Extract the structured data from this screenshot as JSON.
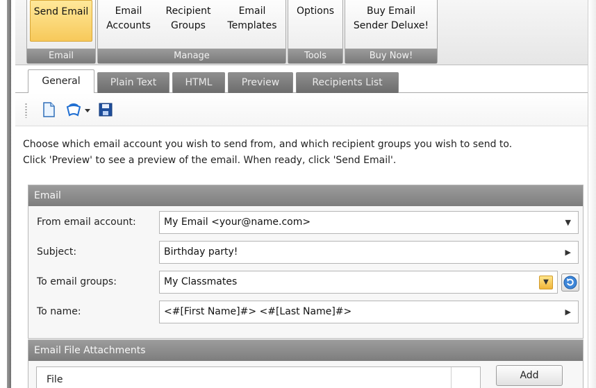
{
  "ribbon": {
    "groups": [
      {
        "footer": "Email",
        "buttons": [
          {
            "label1": "Send Email",
            "label2": ""
          }
        ]
      },
      {
        "footer": "Manage",
        "buttons": [
          {
            "label1": "Email",
            "label2": "Accounts"
          },
          {
            "label1": "Recipient",
            "label2": "Groups"
          },
          {
            "label1": "Email",
            "label2": "Templates"
          }
        ]
      },
      {
        "footer": "Tools",
        "buttons": [
          {
            "label1": "Options",
            "label2": ""
          }
        ]
      },
      {
        "footer": "Buy Now!",
        "buttons": [
          {
            "label1": "Buy Email",
            "label2": "Sender Deluxe!"
          }
        ]
      }
    ]
  },
  "tabs": [
    "General",
    "Plain Text",
    "HTML",
    "Preview",
    "Recipients List"
  ],
  "toolbar": {
    "icons": [
      "new-document-icon",
      "open-icon",
      "dropdown-arrow-icon",
      "save-icon"
    ]
  },
  "description": {
    "line1": "Choose which email account you wish to send from, and which recipient groups you wish to send to.",
    "line2": "Click 'Preview' to see a preview of the email. When ready, click 'Send Email'."
  },
  "email_panel": {
    "title": "Email",
    "fields": [
      {
        "label": "From email account:",
        "value": "My Email <your@name.com>",
        "arrow": "▼"
      },
      {
        "label": "Subject:",
        "value": "Birthday party!",
        "arrow": "▶"
      },
      {
        "label": "To email groups:",
        "value": "My Classmates",
        "arrow": "▼"
      },
      {
        "label": "To name:",
        "value": "<#[First Name]#> <#[Last Name]#>",
        "arrow": "▶"
      }
    ]
  },
  "attachments_panel": {
    "title": "Email File Attachments",
    "column": "File",
    "add_label": "Add"
  },
  "colors": {
    "active_ribbon": "#f7c95a",
    "ribbon_footer": "#7a7a7a",
    "panel_header": "#7d7d7d"
  }
}
